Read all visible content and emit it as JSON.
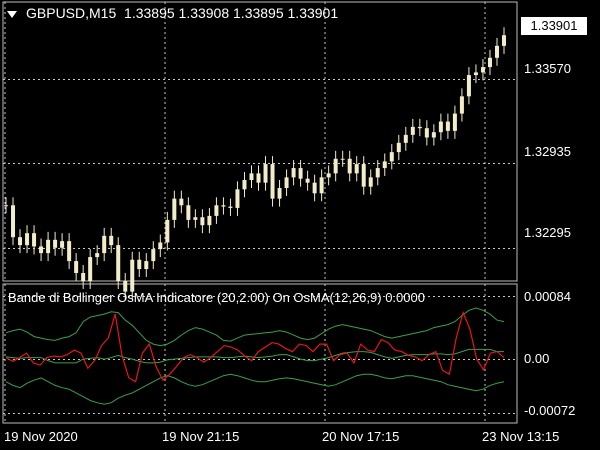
{
  "header": {
    "symbol_timeframe": "GBPUSD,M15",
    "ohlc": "1.33895 1.33908 1.33895 1.33901"
  },
  "price_axis": {
    "current_price": "1.33901",
    "ticks": [
      "1.33570",
      "1.32935",
      "1.32295"
    ]
  },
  "indicator": {
    "title": "Bande di Bollinger OsMA Indicatore (20,2.00) On OsMA(12,26,9) 0.0000",
    "ticks": [
      "0.00084",
      "0.00",
      "-0.00072"
    ]
  },
  "time_axis": {
    "labels": [
      "19 Nov 2020",
      "19 Nov 21:15",
      "20 Nov 17:15",
      "23 Nov 13:15"
    ]
  },
  "colors": {
    "background": "#000000",
    "candle": "#f2edc8",
    "grid": "#c8c8c8",
    "osma_line": "#e8141e",
    "bollinger_bands": "#3aa04a",
    "axis_text": "#ffffff"
  },
  "chart_data": {
    "type": "line",
    "title": "GBPUSD,M15",
    "price_ylim": [
      1.3205,
      1.3415
    ],
    "closes": [
      1.3262,
      1.3238,
      1.3232,
      1.3241,
      1.3231,
      1.3226,
      1.3236,
      1.323,
      1.3235,
      1.322,
      1.3211,
      1.3205,
      1.3223,
      1.3226,
      1.3239,
      1.3232,
      1.3205,
      1.3197,
      1.3221,
      1.3214,
      1.322,
      1.3229,
      1.3234,
      1.3251,
      1.3267,
      1.3262,
      1.3251,
      1.3253,
      1.3247,
      1.3254,
      1.3262,
      1.3261,
      1.326,
      1.3274,
      1.3281,
      1.3286,
      1.3279,
      1.3293,
      1.3267,
      1.3275,
      1.3283,
      1.329,
      1.3282,
      1.3279,
      1.3271,
      1.3283,
      1.3286,
      1.3297,
      1.3297,
      1.3286,
      1.3293,
      1.3276,
      1.3283,
      1.329,
      1.3295,
      1.3302,
      1.3309,
      1.3315,
      1.3321,
      1.332,
      1.3313,
      1.3317,
      1.3325,
      1.3318,
      1.3331,
      1.3344,
      1.336,
      1.3362,
      1.3366,
      1.3373,
      1.3382,
      1.339
    ],
    "osma_ylim": [
      -0.00085,
      0.001
    ],
    "osma_ticks": [
      0.00084,
      0.0,
      -0.00072
    ],
    "osma": [
      2e-05,
      -3e-05,
      2e-05,
      8e-05,
      -5e-05,
      -8e-05,
      2e-05,
      4e-05,
      3e-05,
      6e-05,
      0.00012,
      8e-05,
      -0.00012,
      -2e-05,
      0.00018,
      0.00028,
      0.0006,
      5e-05,
      -0.00025,
      -0.0003,
      8e-05,
      0.0002,
      -0.0001,
      -0.00028,
      -0.0002,
      -0.0001,
      2e-05,
      6e-05,
      2e-05,
      -4e-05,
      2e-05,
      0.0001,
      0.00018,
      0.00016,
      0.00012,
      4e-05,
      -2e-05,
      0.0001,
      0.00016,
      0.00022,
      0.0002,
      0.00014,
      0.0001,
      0.0002,
      0.00018,
      0.0001,
      0.0002,
      0.0002,
      -2e-05,
      6e-05,
      8e-05,
      -5e-05,
      0.0002,
      0.00012,
      0.0001,
      0.00026,
      0.00022,
      0.00012,
      0.0001,
      5e-05,
      3e-05,
      -2e-05,
      6e-05,
      0.0001,
      -0.00015,
      -0.0002,
      0.00028,
      0.00062,
      0.0004,
      0.0,
      -0.00014,
      8e-05,
      0.0001,
      2e-05
    ],
    "upper_band": [
      0.00035,
      0.00038,
      0.0004,
      0.00036,
      0.0003,
      0.00028,
      0.00026,
      0.00025,
      0.00028,
      0.0003,
      0.00035,
      0.0005,
      0.00056,
      0.00058,
      0.0006,
      0.00063,
      0.00062,
      0.00052,
      0.00045,
      0.00035,
      0.00025,
      0.0002,
      0.00018,
      0.0002,
      0.00025,
      0.00032,
      0.00038,
      0.00042,
      0.0004,
      0.00036,
      0.00032,
      0.00025,
      0.00024,
      0.00028,
      0.00032,
      0.00033,
      0.00034,
      0.00035,
      0.00036,
      0.00038,
      0.00036,
      0.00032,
      0.00028,
      0.00026,
      0.00028,
      0.00034,
      0.0004,
      0.00044,
      0.00046,
      0.00044,
      0.00042,
      0.0004,
      0.00038,
      0.00034,
      0.0003,
      0.00028,
      0.0003,
      0.00032,
      0.00034,
      0.00036,
      0.00038,
      0.00042,
      0.00044,
      0.00046,
      0.0005,
      0.00058,
      0.00065,
      0.00068,
      0.00065,
      0.0006,
      0.00052,
      0.0005
    ],
    "lower_band": [
      -0.0003,
      -0.00035,
      -0.00038,
      -0.00032,
      -0.00028,
      -0.00025,
      -0.0003,
      -0.00035,
      -0.00038,
      -0.0004,
      -0.00045,
      -0.0005,
      -0.00055,
      -0.00058,
      -0.0006,
      -0.00058,
      -0.00052,
      -0.00048,
      -0.00045,
      -0.0004,
      -0.00035,
      -0.0003,
      -0.00025,
      -0.00022,
      -0.00025,
      -0.0003,
      -0.00034,
      -0.00036,
      -0.00034,
      -0.0003,
      -0.00026,
      -0.00022,
      -0.0002,
      -0.00022,
      -0.00025,
      -0.00028,
      -0.0003,
      -0.0003,
      -0.00028,
      -0.00026,
      -0.00025,
      -0.00026,
      -0.00028,
      -0.0003,
      -0.00032,
      -0.00034,
      -0.00036,
      -0.00034,
      -0.0003,
      -0.00026,
      -0.00022,
      -0.0002,
      -0.0002,
      -0.00022,
      -0.00025,
      -0.00026,
      -0.00024,
      -0.00022,
      -0.00022,
      -0.00024,
      -0.00026,
      -0.00028,
      -0.0003,
      -0.00034,
      -0.00036,
      -0.00038,
      -0.0004,
      -0.00042,
      -0.0004,
      -0.00035,
      -0.00032,
      -0.0003
    ],
    "mid_band": [
      3e-05,
      2e-05,
      1e-05,
      2e-05,
      2e-05,
      2e-05,
      -2e-05,
      -5e-05,
      -5e-05,
      -5e-05,
      -5e-05,
      0.0,
      1e-05,
      2e-05,
      0.0,
      2e-05,
      5e-05,
      2e-05,
      0.0,
      -3e-05,
      -5e-05,
      -5e-05,
      -4e-05,
      -1e-05,
      0.0,
      1e-05,
      2e-05,
      3e-05,
      3e-05,
      3e-05,
      3e-05,
      2e-05,
      2e-05,
      3e-05,
      4e-05,
      3e-05,
      2e-05,
      3e-05,
      4e-05,
      6e-05,
      6e-05,
      3e-05,
      0.0,
      -2e-05,
      -2e-05,
      0.0,
      2e-05,
      5e-05,
      8e-05,
      9e-05,
      0.0001,
      0.0001,
      9e-05,
      6e-05,
      3e-05,
      1e-05,
      3e-05,
      5e-05,
      6e-05,
      6e-05,
      6e-05,
      7e-05,
      7e-05,
      6e-05,
      7e-05,
      0.0001,
      0.00013,
      0.00013,
      0.00013,
      0.00013,
      0.0001,
      0.0001
    ]
  }
}
